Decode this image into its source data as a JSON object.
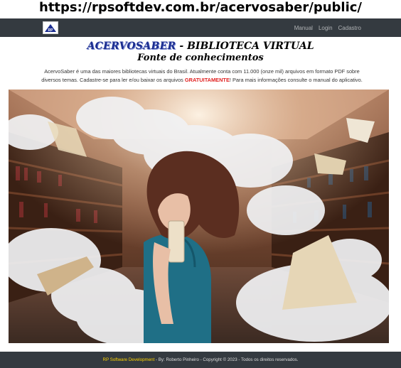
{
  "url_caption": "https://rpsoftdev.com.br/acervosaber/public/",
  "navbar": {
    "logo_icon": "rp-logo-icon",
    "links": [
      "Manual",
      "Login",
      "Cadastro"
    ]
  },
  "hero": {
    "brand_name": "ACERVOSABER",
    "separator": "-",
    "subtitle": "BIBLIOTECA VIRTUAL",
    "tagline": "Fonte de conhecimentos"
  },
  "intro": {
    "text_before": "AcervoSaber é uma das maiores bibliotecas virtuais do Brasil. Atualmente conta com 11.000 (onze mil) arquivos em formato PDF sobre diversos temas. Cadastre-se para ler e/ou baixar os arquivos",
    "highlight": "GRATUITAMENTE",
    "text_after": "! Para mais informações consulte o manual do aplicativo."
  },
  "footer": {
    "company": "RP Software Development",
    "rest": " - By: Roberto Pinheiro - Copyright © 2023 - Todos os direitos reservados."
  },
  "colors": {
    "navbar_bg": "#343a40",
    "brand_blue": "#1b2d8f",
    "highlight_red": "#e01f1f",
    "footer_company": "#ffd400"
  }
}
